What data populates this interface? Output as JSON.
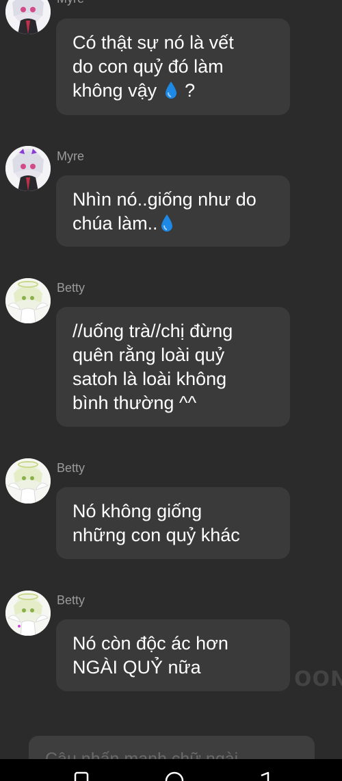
{
  "messages": [
    {
      "sender": "Myre",
      "lines": [
        "Có thật sự nó là vết",
        "do con quỷ đó làm",
        "không vậy"
      ],
      "drop_after_line": 2,
      "trailing": " ?"
    },
    {
      "sender": "Myre",
      "lines": [
        "Nhìn nó..giống như do",
        "chúa làm.."
      ],
      "drop_after_line": 1,
      "trailing": ""
    },
    {
      "sender": "Betty",
      "lines": [
        "//uống trà//chị đừng",
        "quên rằng loài quỷ",
        "satoh là loài không",
        "bình thường ^^"
      ]
    },
    {
      "sender": "Betty",
      "lines": [
        "Nó không giống",
        "những con quỷ khác"
      ]
    },
    {
      "sender": "Betty",
      "lines": [
        "Nó còn độc ác hơn",
        "NGÀI QUỶ nữa"
      ]
    }
  ],
  "input": {
    "placeholder": "Câu nhấn mạnh chữ ngài"
  },
  "watermark": "OON",
  "colors": {
    "background": "#2b2b2b",
    "bubble": "#3a3a3a",
    "sender": "#9b9b9b",
    "drop": "#1e88e5"
  },
  "icons": [
    "water-drop-icon",
    "recent-apps-icon",
    "home-icon",
    "back-icon"
  ]
}
